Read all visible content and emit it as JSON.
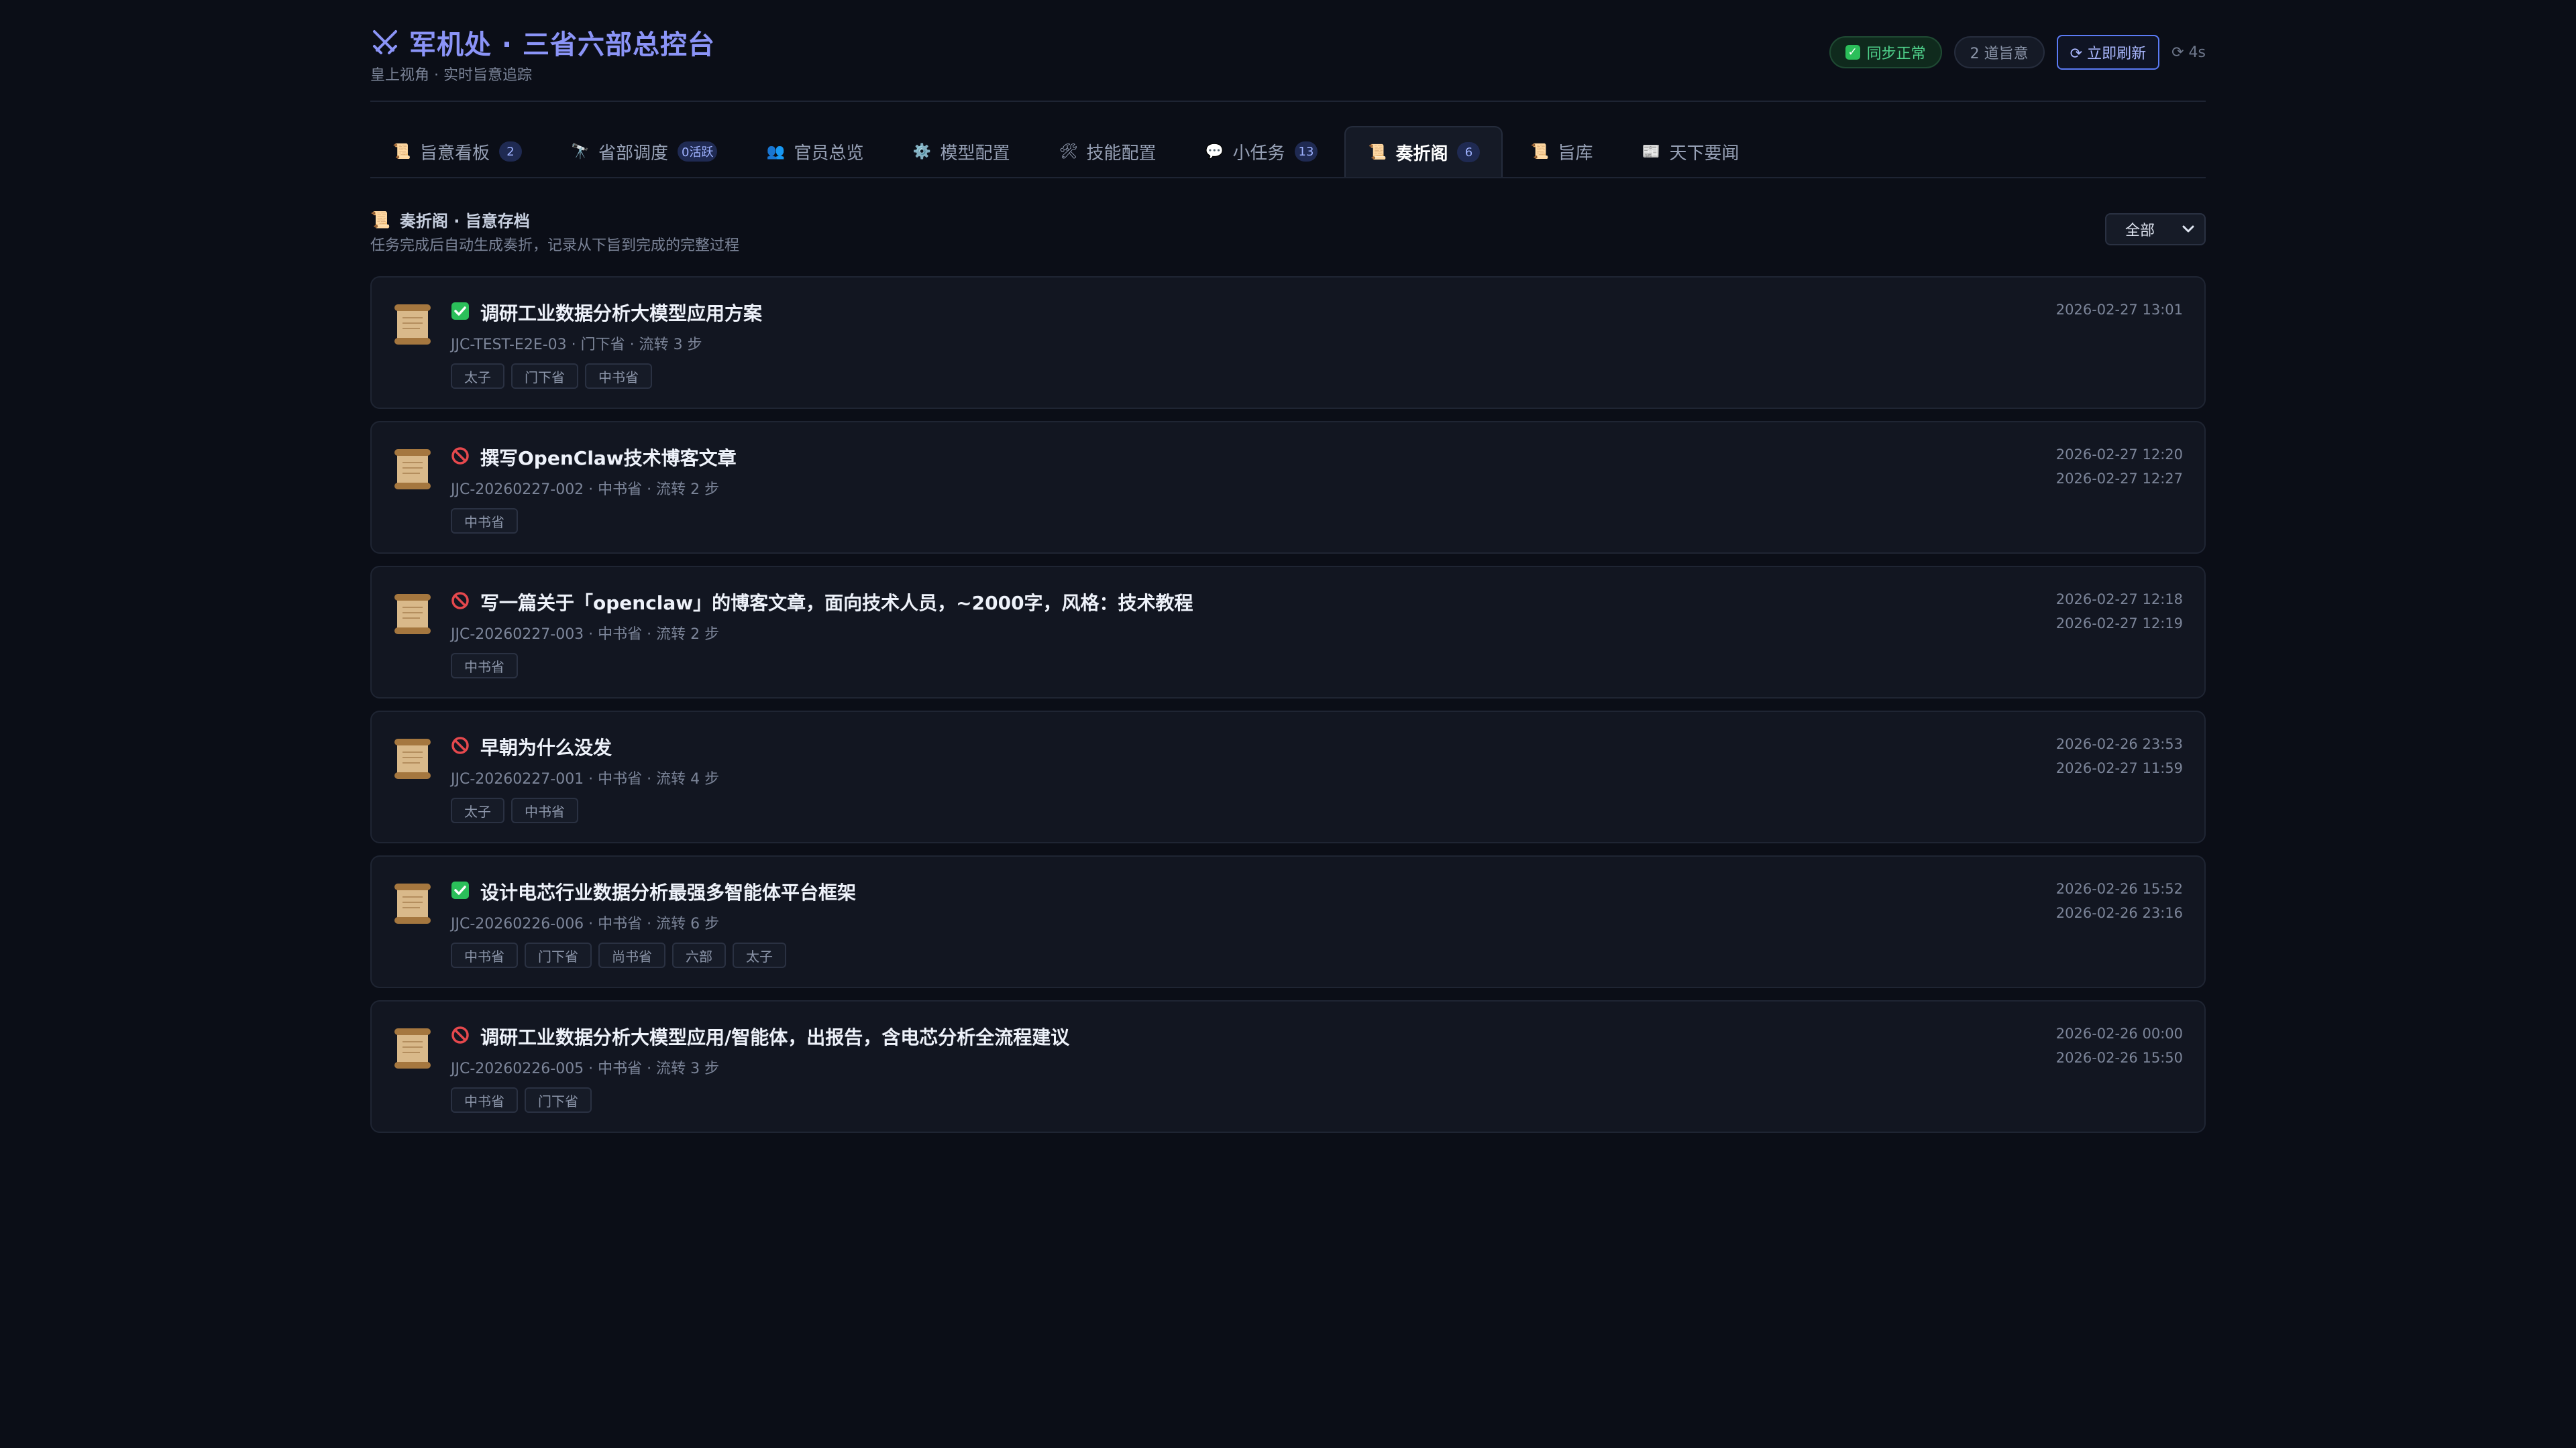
{
  "header": {
    "title": "军机处 · 三省六部总控台",
    "subtitle": "皇上视角 · 实时旨意追踪",
    "sync_status": "同步正常",
    "edict_count": "2 道旨意",
    "refresh_label": "⟳ 立即刷新",
    "countdown": "⟳ 4s"
  },
  "tabs": [
    {
      "icon": "📜",
      "label": "旨意看板",
      "badge": "2"
    },
    {
      "icon": "🔭",
      "label": "省部调度",
      "badge": "0活跃"
    },
    {
      "icon": "👥",
      "label": "官员总览",
      "badge": ""
    },
    {
      "icon": "⚙️",
      "label": "模型配置",
      "badge": ""
    },
    {
      "icon": "🛠",
      "label": "技能配置",
      "badge": ""
    },
    {
      "icon": "💬",
      "label": "小任务",
      "badge": "13"
    },
    {
      "icon": "📜",
      "label": "奏折阁",
      "badge": "6",
      "active": true
    },
    {
      "icon": "📜",
      "label": "旨库",
      "badge": ""
    },
    {
      "icon": "📰",
      "label": "天下要闻",
      "badge": ""
    }
  ],
  "section": {
    "title": "奏折阁 · 旨意存档",
    "description": "任务完成后自动生成奏折，记录从下旨到完成的完整过程",
    "filter_value": "全部"
  },
  "memorials": [
    {
      "status": "done",
      "title": "调研工业数据分析大模型应用方案",
      "meta": "JJC-TEST-E2E-03 · 门下省 · 流转 3 步",
      "tags": [
        "太子",
        "门下省",
        "中书省"
      ],
      "times": [
        "2026-02-27 13:01"
      ]
    },
    {
      "status": "cancelled",
      "title": "撰写OpenClaw技术博客文章",
      "meta": "JJC-20260227-002 · 中书省 · 流转 2 步",
      "tags": [
        "中书省"
      ],
      "times": [
        "2026-02-27 12:20",
        "2026-02-27 12:27"
      ]
    },
    {
      "status": "cancelled",
      "title": "写一篇关于「openclaw」的博客文章，面向技术人员，~2000字，风格：技术教程",
      "meta": "JJC-20260227-003 · 中书省 · 流转 2 步",
      "tags": [
        "中书省"
      ],
      "times": [
        "2026-02-27 12:18",
        "2026-02-27 12:19"
      ]
    },
    {
      "status": "cancelled",
      "title": "早朝为什么没发",
      "meta": "JJC-20260227-001 · 中书省 · 流转 4 步",
      "tags": [
        "太子",
        "中书省"
      ],
      "times": [
        "2026-02-26 23:53",
        "2026-02-27 11:59"
      ]
    },
    {
      "status": "done",
      "title": "设计电芯行业数据分析最强多智能体平台框架",
      "meta": "JJC-20260226-006 · 中书省 · 流转 6 步",
      "tags": [
        "中书省",
        "门下省",
        "尚书省",
        "六部",
        "太子"
      ],
      "times": [
        "2026-02-26 15:52",
        "2026-02-26 23:16"
      ]
    },
    {
      "status": "cancelled",
      "title": "调研工业数据分析大模型应用/智能体，出报告，含电芯分析全流程建议",
      "meta": "JJC-20260226-005 · 中书省 · 流转 3 步",
      "tags": [
        "中书省",
        "门下省"
      ],
      "times": [
        "2026-02-26 00:00",
        "2026-02-26 15:50"
      ]
    }
  ],
  "colors": {
    "accent": "#8b94f7",
    "done": "#2bbf5a",
    "cancelled": "#e5484d",
    "background": "#0b0e17"
  }
}
